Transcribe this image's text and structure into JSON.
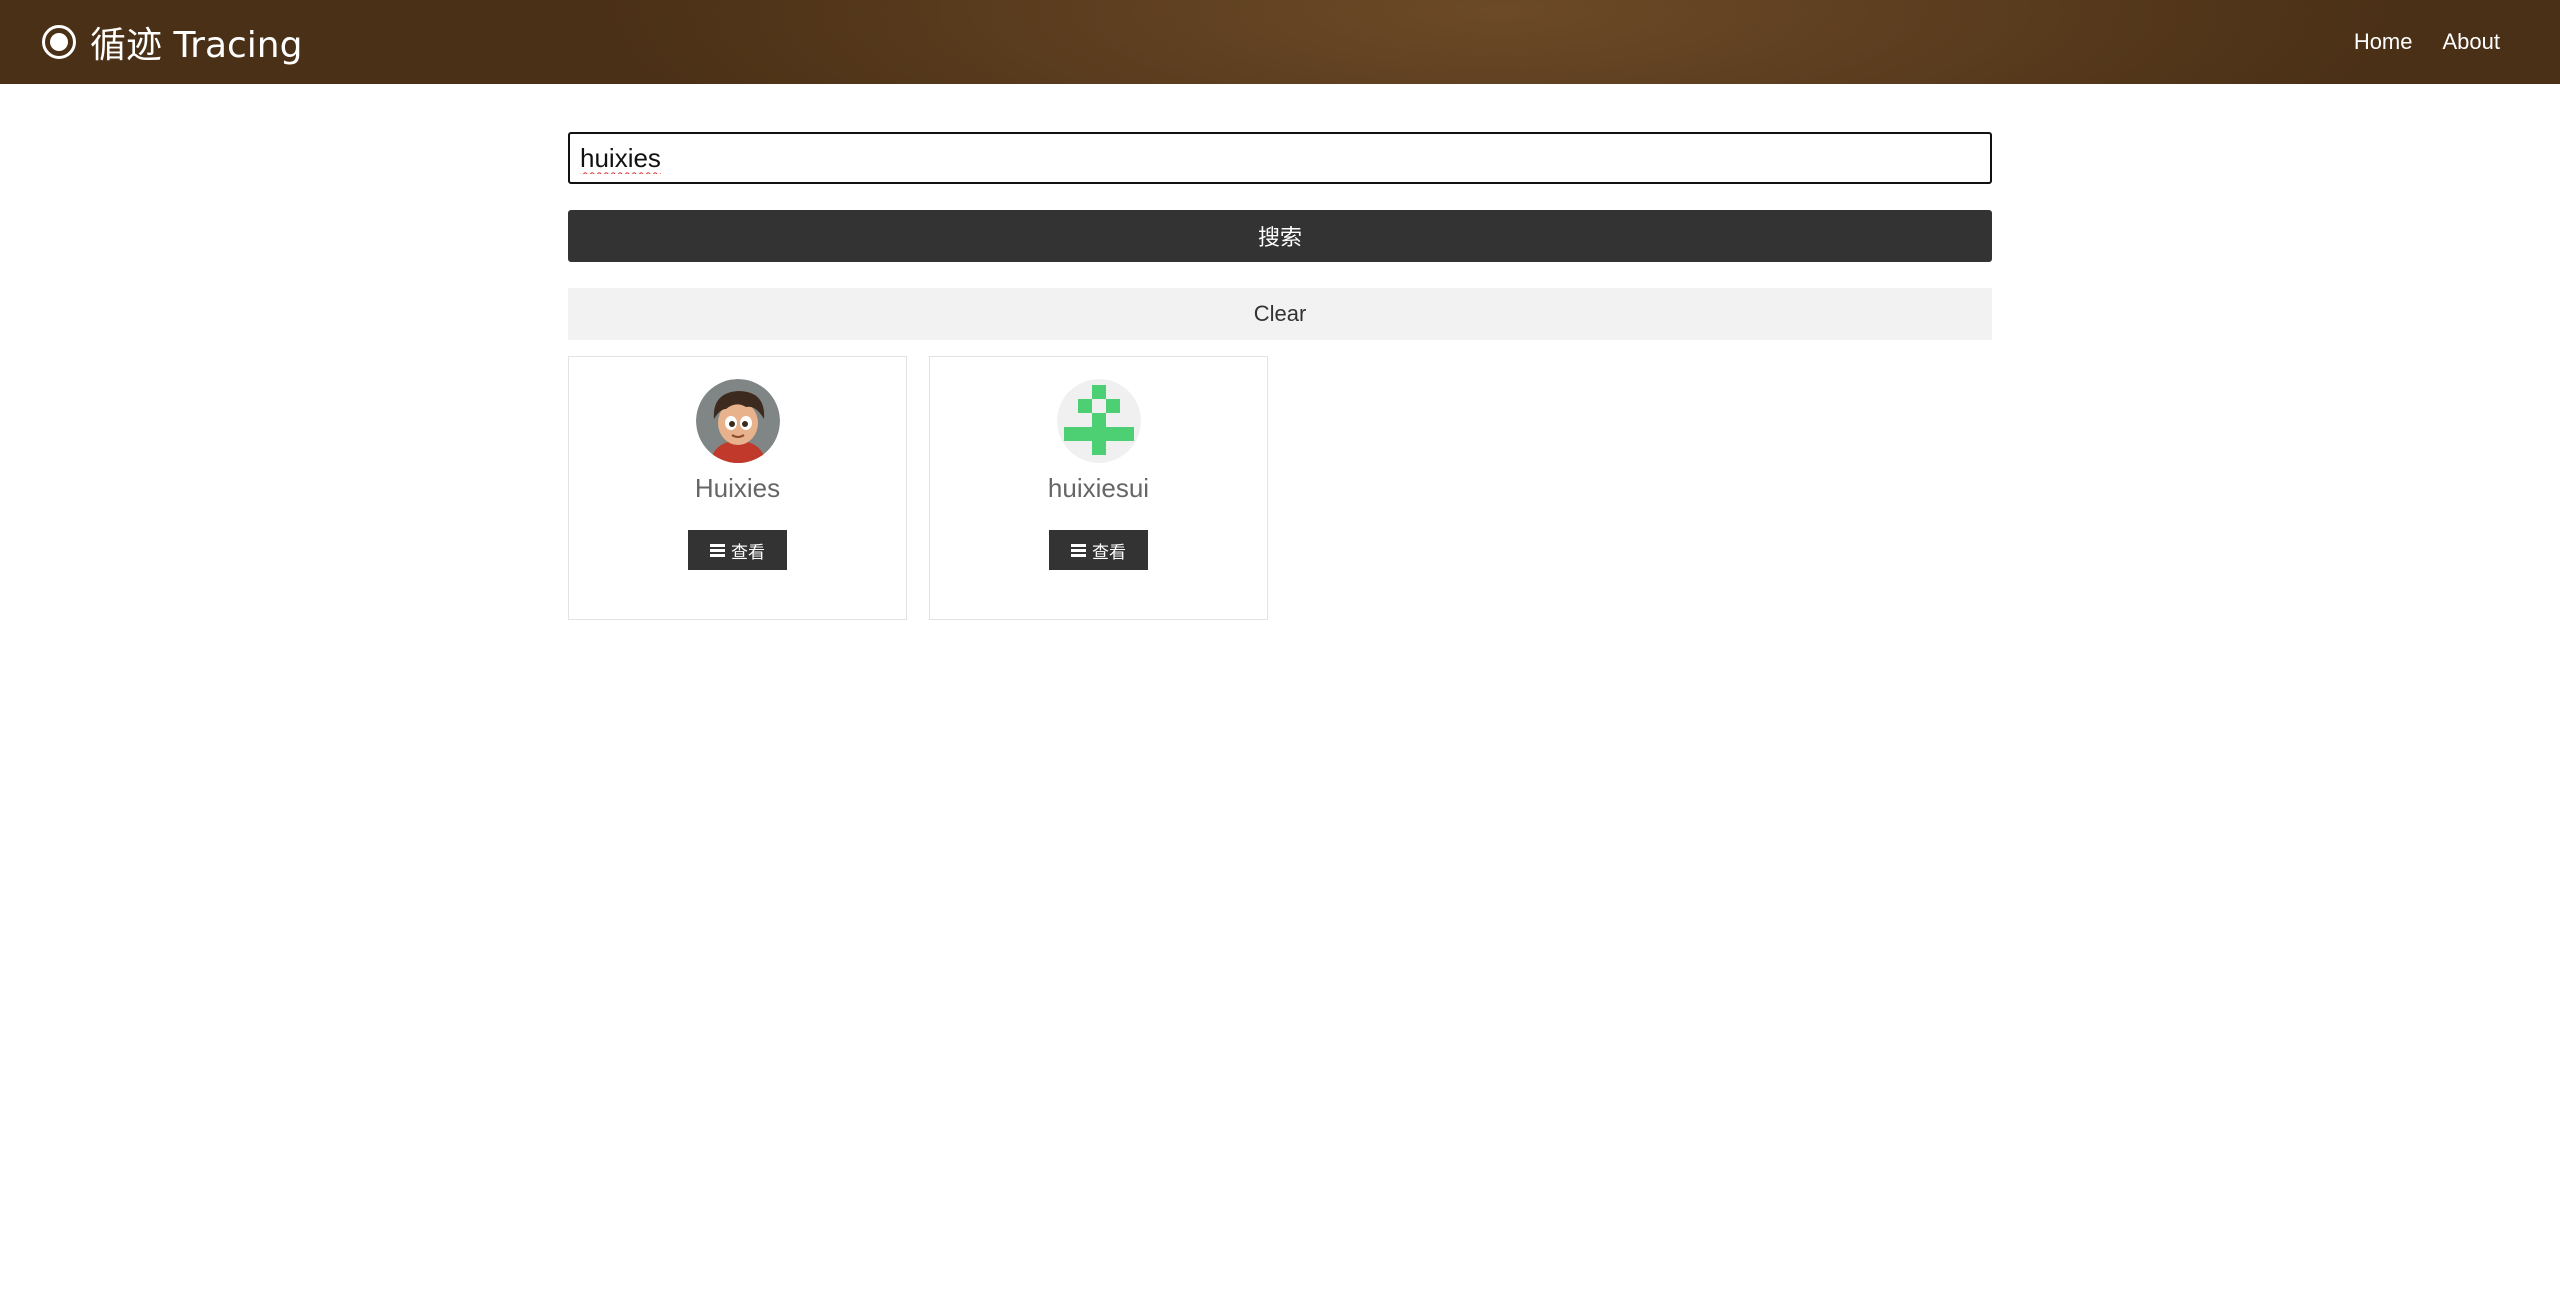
{
  "header": {
    "brand_title": "循迹 Tracing",
    "nav": [
      {
        "label": "Home"
      },
      {
        "label": "About"
      }
    ]
  },
  "search": {
    "value": "huixies",
    "button_label": "搜索",
    "clear_label": "Clear"
  },
  "results": [
    {
      "name": "Huixies",
      "view_label": "查看",
      "avatar": "cartoon-boy-avatar"
    },
    {
      "name": "huixiesui",
      "view_label": "查看",
      "avatar": "green-identicon-avatar"
    }
  ],
  "colors": {
    "navbar": "#5a3c1e",
    "button_dark": "#333333",
    "clear_bg": "#f2f2f2",
    "identicon": "#4cd073"
  }
}
